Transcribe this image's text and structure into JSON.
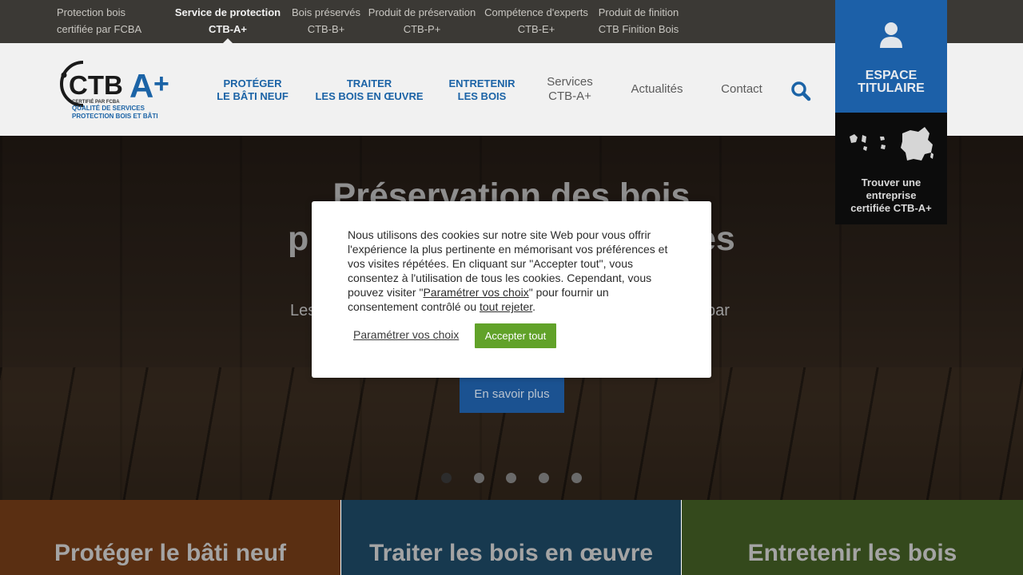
{
  "colors": {
    "topbar": "#3b3935",
    "header": "#f1f1f1",
    "brand_blue": "#1b63a6",
    "espace_blue": "#1c60a8",
    "accept_green": "#61a229",
    "tile_orange": "#b3591c",
    "tile_blue": "#216f9e",
    "tile_green": "#6a9a34"
  },
  "topbar": {
    "items": [
      {
        "line1": "Protection bois",
        "line2": "certifiée par FCBA",
        "active": false
      },
      {
        "line1": "Service de protection",
        "line2": "CTB-A+",
        "active": true
      },
      {
        "line1": "Bois préservés",
        "line2": "CTB-B+",
        "active": false
      },
      {
        "line1": "Produit de préservation",
        "line2": "CTB-P+",
        "active": false
      },
      {
        "line1": "Compétence d'experts",
        "line2": "CTB-E+",
        "active": false
      },
      {
        "line1": "Produit de finition",
        "line2": "CTB Finition Bois",
        "active": false
      }
    ]
  },
  "logo": {
    "brand": "CTBA+",
    "certified": "CERTIFIÉ PAR FCBA",
    "tagline1": "QUALITÉ DE SERVICES",
    "tagline2": "PROTECTION BOIS ET BÂTI"
  },
  "nav": {
    "items": [
      {
        "line1": "PROTÉGER",
        "line2": "LE BÂTI NEUF"
      },
      {
        "line1": "TRAITER",
        "line2": "LES BOIS EN ŒUVRE"
      },
      {
        "line1": "ENTRETENIR",
        "line2": "LES BOIS"
      },
      {
        "line1": "Services",
        "line2": "CTB-A+"
      },
      {
        "line1": "Actualités",
        "line2": ""
      },
      {
        "line1": "Contact",
        "line2": ""
      }
    ],
    "search_icon": "search-icon"
  },
  "espace": {
    "line1": "ESPACE",
    "line2": "TITULAIRE",
    "icon": "user-icon"
  },
  "trouver": {
    "line1": "Trouver une",
    "line2": "entreprise",
    "line3": "certifiée CTB-A+",
    "icon": "france-map-icon"
  },
  "hero": {
    "title_line1": "Préservation des bois",
    "title_line2_left": "p",
    "title_line2_right": "es",
    "subtitle_left": "Les",
    "subtitle_right": "par",
    "button": "En savoir plus",
    "slides_total": 5,
    "active_slide": 1
  },
  "cookie": {
    "text_part1": "Nous utilisons des cookies sur notre site Web pour vous offrir l'expérience la plus pertinente en mémorisant vos préférences et vos visites répétées. En cliquant sur \"Accepter tout\", vous consentez à l'utilisation de tous les cookies. Cependant, vous pouvez visiter \"",
    "link_settings": "Paramétrer vos choix",
    "text_part2": "\" pour fournir un consentement contrôlé ou ",
    "link_reject": "tout rejeter",
    "text_part3": ".",
    "settings_button": "Paramétrer vos choix",
    "accept_button": "Accepter tout"
  },
  "tiles": [
    {
      "label": "Protéger le bâti neuf"
    },
    {
      "label": "Traiter les bois en œuvre"
    },
    {
      "label": "Entretenir les bois"
    }
  ]
}
